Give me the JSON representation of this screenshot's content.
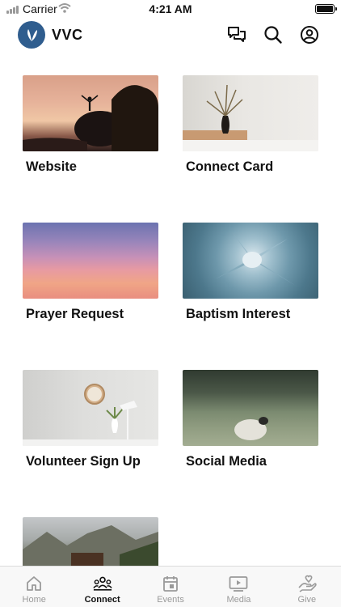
{
  "status_bar": {
    "carrier": "Carrier",
    "time": "4:21 AM"
  },
  "header": {
    "title": "VVC"
  },
  "cards": [
    {
      "label": "Website"
    },
    {
      "label": "Connect Card"
    },
    {
      "label": "Prayer Request"
    },
    {
      "label": "Baptism Interest"
    },
    {
      "label": "Volunteer Sign Up"
    },
    {
      "label": "Social Media"
    },
    {
      "label": ""
    }
  ],
  "tabs": [
    {
      "label": "Home",
      "icon": "home-icon",
      "active": false
    },
    {
      "label": "Connect",
      "icon": "people-icon",
      "active": true
    },
    {
      "label": "Events",
      "icon": "calendar-icon",
      "active": false
    },
    {
      "label": "Media",
      "icon": "play-icon",
      "active": false
    },
    {
      "label": "Give",
      "icon": "heart-hand-icon",
      "active": false
    }
  ],
  "colors": {
    "brand": "#2f5d8e",
    "active_tab": "#111111",
    "inactive_tab": "#9a9a9a"
  }
}
